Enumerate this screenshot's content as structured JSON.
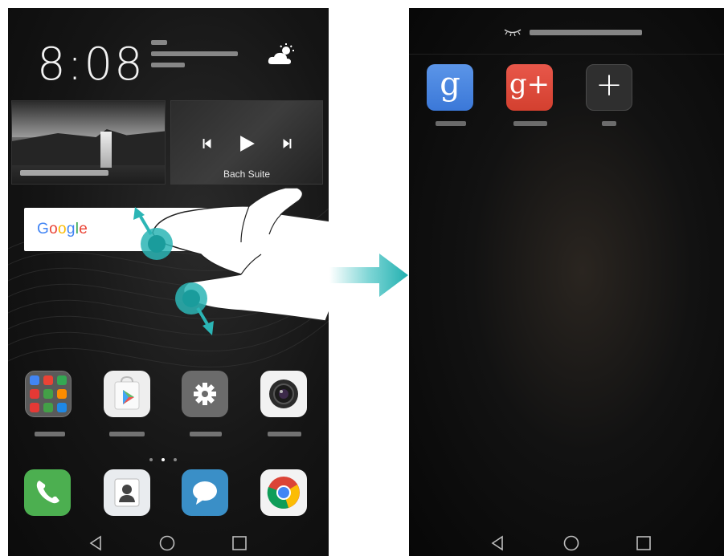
{
  "left_screen": {
    "clock": "8:08",
    "music_widget": {
      "track_title": "Bach Suite"
    },
    "search_widget": {
      "brand_text": "Google"
    },
    "home_apps": [
      {
        "name": "folder-google",
        "icon": "folder-icon"
      },
      {
        "name": "play-store",
        "icon": "play-store-icon"
      },
      {
        "name": "settings",
        "icon": "gear-icon"
      },
      {
        "name": "camera",
        "icon": "camera-icon"
      }
    ],
    "dock_apps": [
      {
        "name": "phone",
        "icon": "phone-icon"
      },
      {
        "name": "contacts",
        "icon": "contacts-icon"
      },
      {
        "name": "messages",
        "icon": "message-icon"
      },
      {
        "name": "chrome",
        "icon": "chrome-icon"
      }
    ],
    "page_indicator": {
      "pages": 3,
      "active_index": 1
    }
  },
  "right_screen": {
    "hidden_apps": [
      {
        "letter": "g",
        "icon": "google-icon"
      },
      {
        "letter": "g+",
        "icon": "google-plus-icon"
      },
      {
        "letter": "+",
        "icon": "add-icon"
      }
    ]
  },
  "colors": {
    "accent_teal": "#2bb5b5",
    "google_blue": "#4285f4",
    "google_red": "#ea4335",
    "google_yellow": "#fbbc05",
    "google_green": "#34a853"
  }
}
